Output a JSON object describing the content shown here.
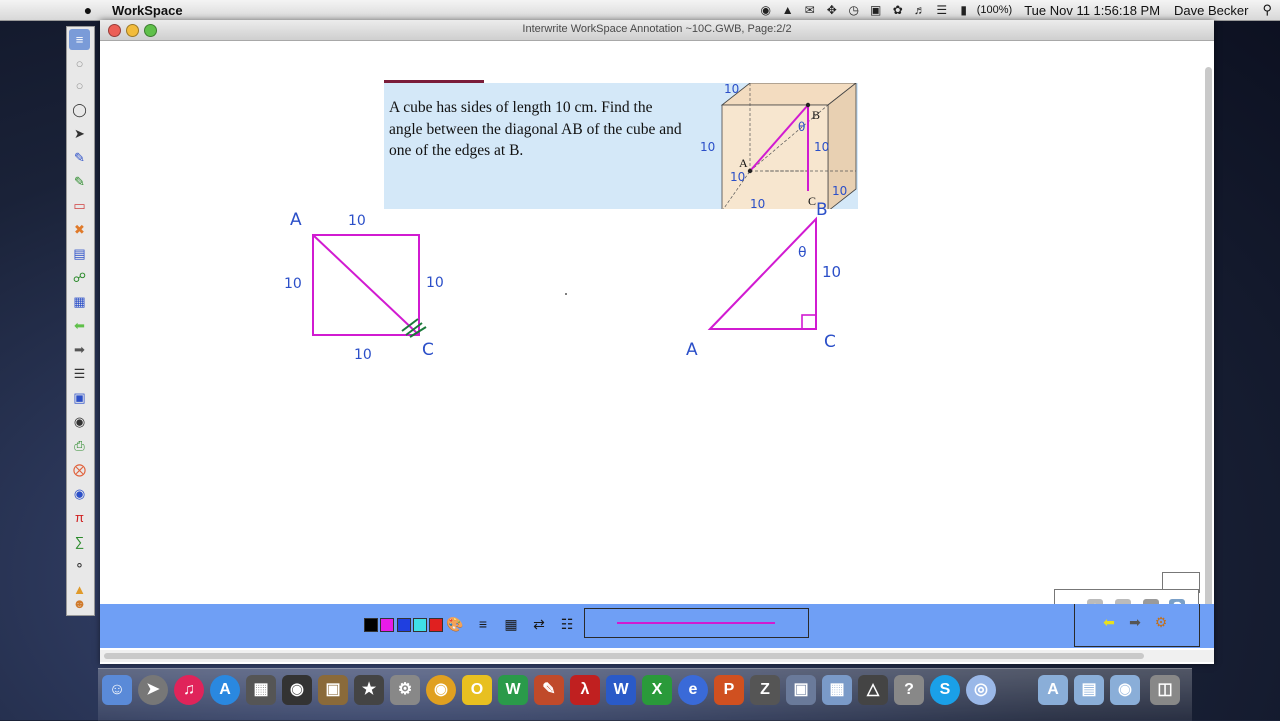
{
  "menubar": {
    "apple": "",
    "app_name": "WorkSpace",
    "battery": "(100%)",
    "clock": "Tue Nov 11  1:56:18 PM",
    "user": "Dave Becker"
  },
  "window": {
    "title": "Interwrite WorkSpace Annotation ~10C.GWB, Page:2/2"
  },
  "question": {
    "text": "A cube has sides of length 10 cm.  Find the angle between the diagonal AB of the cube and one of the edges at B.",
    "figure": {
      "label_a": "A",
      "label_b": "B",
      "label_c": "C",
      "hand_top": "10",
      "hand_left": "10",
      "hand_mid": "10",
      "hand_diag": "10",
      "hand_bottom": "10",
      "hand_right": "10",
      "theta": "θ"
    }
  },
  "annotations": {
    "square": {
      "label_a": "A",
      "label_c": "C",
      "top": "10",
      "left": "10",
      "right": "10",
      "bottom": "10"
    },
    "triangle": {
      "label_a": "A",
      "label_b": "B",
      "label_c": "C",
      "side": "10",
      "theta": "θ"
    }
  },
  "bottom_toolbar": {
    "colors": [
      "#000000",
      "#e81be8",
      "#1f3fe0",
      "#3fe0e8",
      "#e02020"
    ],
    "line_preview_color": "#d11bd1"
  },
  "zoom_panel": {
    "zoom_in": "+",
    "zoom_out": "−"
  }
}
